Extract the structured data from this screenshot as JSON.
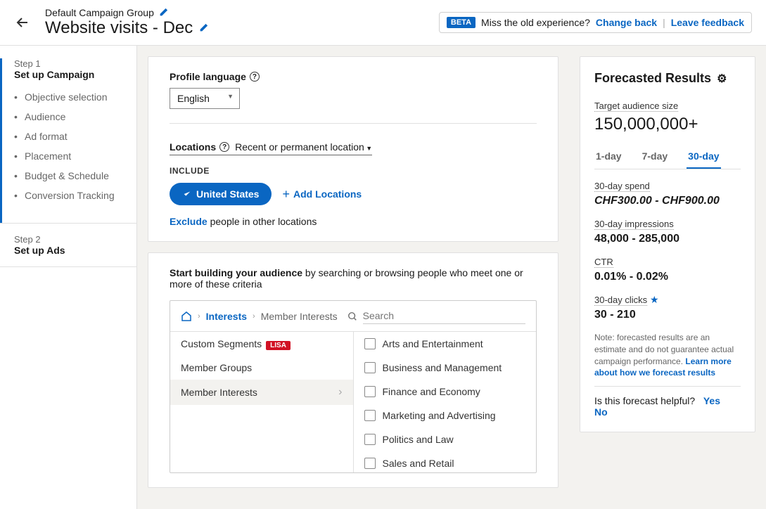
{
  "header": {
    "breadcrumb": "Default Campaign Group",
    "title": "Website visits - Dec",
    "beta": "BETA",
    "old_exp": "Miss the old experience?",
    "change_back": "Change back",
    "leave_feedback": "Leave feedback"
  },
  "sidebar": {
    "step1_num": "Step 1",
    "step1_title": "Set up Campaign",
    "items": [
      "Objective selection",
      "Audience",
      "Ad format",
      "Placement",
      "Budget & Schedule",
      "Conversion Tracking"
    ],
    "step2_num": "Step 2",
    "step2_title": "Set up Ads"
  },
  "profile": {
    "label": "Profile language",
    "value": "English"
  },
  "locations": {
    "label": "Locations",
    "scope": "Recent or permanent location",
    "include": "INCLUDE",
    "pill": "United States",
    "add": "Add Locations",
    "exclude": "Exclude",
    "exclude_text": "people in other locations"
  },
  "audience": {
    "intro_bold": "Start building your audience",
    "intro_rest": " by searching or browsing people who meet one or more of these criteria",
    "crumb1": "Interests",
    "crumb2": "Member Interests",
    "search_placeholder": "Search",
    "left": [
      "Custom Segments",
      "Member Groups",
      "Member Interests"
    ],
    "lisa": "LISA",
    "right": [
      "Arts and Entertainment",
      "Business and Management",
      "Finance and Economy",
      "Marketing and Advertising",
      "Politics and Law",
      "Sales and Retail"
    ]
  },
  "forecast": {
    "title": "Forecasted Results",
    "audience_label": "Target audience size",
    "audience_val": "150,000,000+",
    "tabs": [
      "1-day",
      "7-day",
      "30-day"
    ],
    "spend_label": "30-day spend",
    "spend_val": "CHF300.00 - CHF900.00",
    "impressions_label": "30-day impressions",
    "impressions_val": "48,000 - 285,000",
    "ctr_label": "CTR",
    "ctr_val": "0.01% - 0.02%",
    "clicks_label": "30-day clicks",
    "clicks_val": "30 - 210",
    "note": "Note: forecasted results are an estimate and do not guarantee actual campaign performance.",
    "learn": "Learn more about how we forecast results",
    "helpful": "Is this forecast helpful?",
    "yes": "Yes",
    "no": "No"
  }
}
